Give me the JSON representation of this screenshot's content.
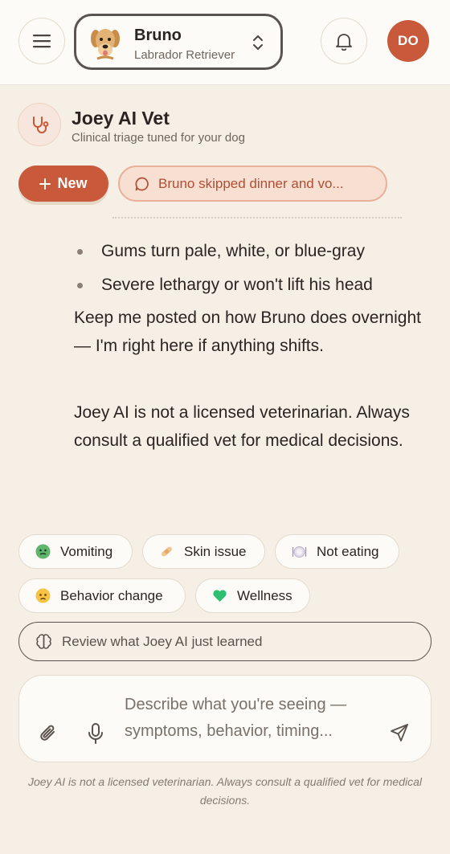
{
  "header": {
    "menu_icon": "hamburger-menu-icon",
    "pet": {
      "name": "Bruno",
      "breed": "Labrador Retriever"
    },
    "bell_icon": "bell-icon",
    "user_initials": "DO",
    "accent": "#c8593b"
  },
  "assistant": {
    "icon": "stethoscope-icon",
    "title": "Joey AI Vet",
    "subtitle": "Clinical triage tuned for your dog"
  },
  "actions": {
    "new_label": "New",
    "thread_label": "Bruno skipped dinner and vo..."
  },
  "message": {
    "bullets": [
      "Gums turn pale, white, or blue-gray",
      "Severe lethargy or won't lift his head"
    ],
    "paragraphs": [
      "Keep me posted on how Bruno does overnight — I'm right here if anything shifts.",
      "Joey AI is not a licensed veterinarian. Always consult a qualified vet for medical decisions."
    ]
  },
  "quick_topics": [
    {
      "label": "Vomiting",
      "icon": "nauseated-face-icon"
    },
    {
      "label": "Skin issue",
      "icon": "bandage-icon"
    },
    {
      "label": "Not eating",
      "icon": "plate-icon"
    },
    {
      "label": "Behavior change",
      "icon": "worried-face-icon"
    },
    {
      "label": "Wellness",
      "icon": "green-heart-icon"
    }
  ],
  "review": {
    "label": "Review what Joey AI just learned",
    "icon": "brain-icon"
  },
  "composer": {
    "placeholder": "Describe what you're seeing — symptoms, behavior, timing...",
    "attach_icon": "paperclip-icon",
    "mic_icon": "microphone-icon",
    "send_icon": "send-icon"
  },
  "footer": {
    "disclaimer": "Joey AI is not a licensed veterinarian. Always consult a qualified vet for medical decisions."
  }
}
